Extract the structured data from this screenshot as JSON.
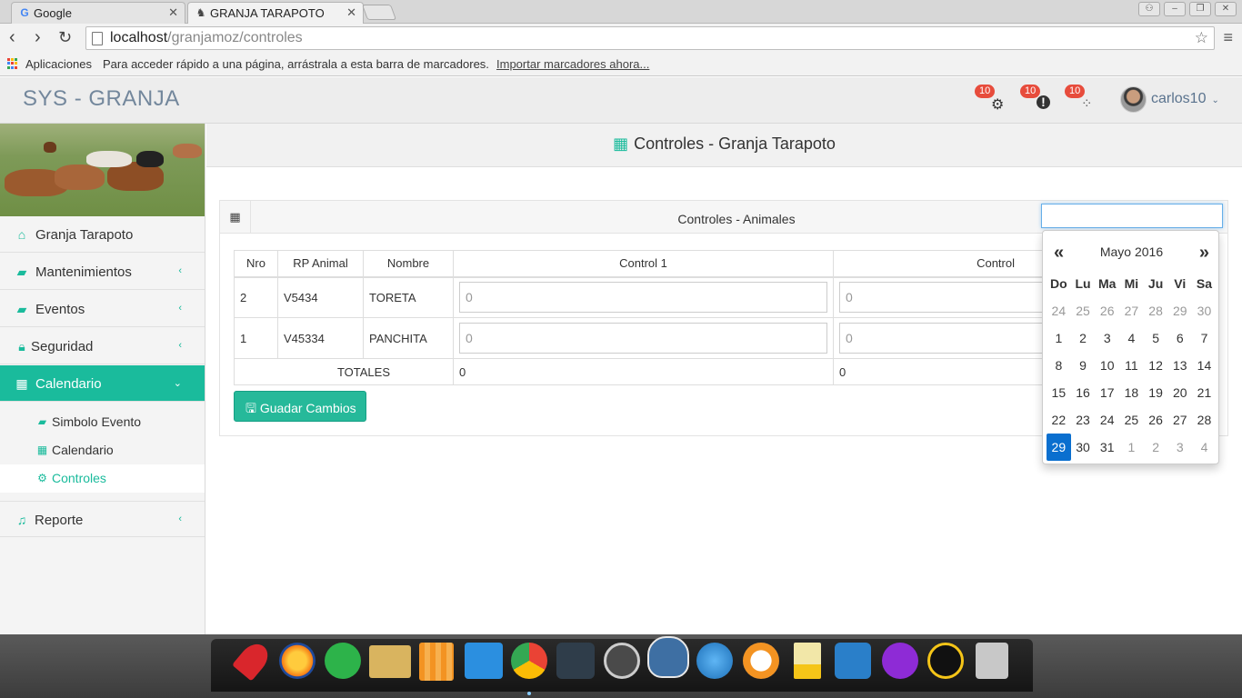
{
  "browser": {
    "tabs": [
      {
        "title": "Google"
      },
      {
        "title": "GRANJA TARAPOTO"
      }
    ],
    "url_host": "localhost",
    "url_path": "/granjamoz/controles",
    "bookmarks": {
      "apps_label": "Aplicaciones",
      "hint": "Para acceder rápido a una página, arrástrala a esta barra de marcadores.",
      "import_link": "Importar marcadores ahora..."
    }
  },
  "header": {
    "brand": "SYS - GRANJA",
    "notifications": [
      {
        "icon": "gear-icon",
        "count": "10"
      },
      {
        "icon": "alert-icon",
        "count": "10"
      },
      {
        "icon": "spinner-icon",
        "count": "10"
      }
    ],
    "user": "carlos10"
  },
  "sidebar": {
    "items": [
      {
        "label": "Granja Tarapoto",
        "icon": "home-icon"
      },
      {
        "label": "Mantenimientos",
        "icon": "book-icon"
      },
      {
        "label": "Eventos",
        "icon": "book-icon"
      },
      {
        "label": "Seguridad",
        "icon": "lock-icon"
      },
      {
        "label": "Calendario",
        "icon": "calendar-icon"
      },
      {
        "label": "Reporte",
        "icon": "music-icon"
      }
    ],
    "subitems": [
      {
        "label": "Simbolo Evento",
        "icon": "book-icon"
      },
      {
        "label": "Calendario",
        "icon": "calendar-icon"
      },
      {
        "label": "Controles",
        "icon": "gear-icon"
      }
    ]
  },
  "page": {
    "title": "Controles - Granja Tarapoto",
    "panel_title": "Controles - Animales",
    "table": {
      "headers": [
        "Nro",
        "RP Animal",
        "Nombre",
        "Control 1",
        "Control"
      ],
      "rows": [
        {
          "nro": "2",
          "rp": "V5434",
          "nombre": "TORETA",
          "c1": "0",
          "c2": "0"
        },
        {
          "nro": "1",
          "rp": "V45334",
          "nombre": "PANCHITA",
          "c1": "0",
          "c2": "0"
        }
      ],
      "totals_label": "TOTALES",
      "totals": [
        "0",
        "0"
      ]
    },
    "save_button": "Guadar Cambios"
  },
  "datepicker": {
    "prev": "«",
    "next": "»",
    "month": "Mayo 2016",
    "weekdays": [
      "Do",
      "Lu",
      "Ma",
      "Mi",
      "Ju",
      "Vi",
      "Sa"
    ],
    "days": [
      "24",
      "25",
      "26",
      "27",
      "28",
      "29",
      "30",
      "1",
      "2",
      "3",
      "4",
      "5",
      "6",
      "7",
      "8",
      "9",
      "10",
      "11",
      "12",
      "13",
      "14",
      "15",
      "16",
      "17",
      "18",
      "19",
      "20",
      "21",
      "22",
      "23",
      "24",
      "25",
      "26",
      "27",
      "28",
      "29",
      "30",
      "31",
      "1",
      "2",
      "3",
      "4"
    ],
    "selected_day": "29"
  }
}
